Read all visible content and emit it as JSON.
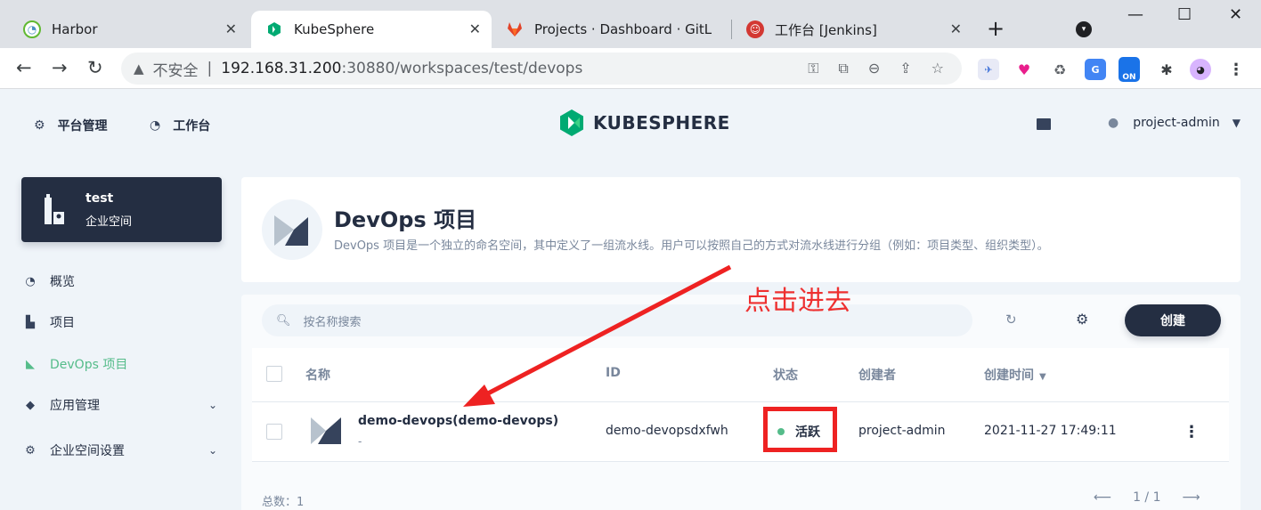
{
  "browser": {
    "tabs": [
      {
        "title": "Harbor",
        "active": false
      },
      {
        "title": "KubeSphere",
        "active": true
      },
      {
        "title": "Projects · Dashboard · GitL",
        "active": false
      },
      {
        "title": "工作台 [Jenkins]",
        "active": false
      }
    ],
    "address": {
      "security_label": "不安全",
      "host": "192.168.31.200",
      "path": ":30880/workspaces/test/devops"
    },
    "extension_badge": "ON"
  },
  "header": {
    "nav": [
      {
        "label": "平台管理"
      },
      {
        "label": "工作台"
      }
    ],
    "logo_text": "KUBESPHERE",
    "user": "project-admin"
  },
  "workspace": {
    "name": "test",
    "type": "企业空间"
  },
  "sidebar": {
    "items": [
      {
        "label": "概览"
      },
      {
        "label": "项目"
      },
      {
        "label": "DevOps 项目"
      },
      {
        "label": "应用管理"
      },
      {
        "label": "企业空间设置"
      }
    ]
  },
  "banner": {
    "title": "DevOps 项目",
    "description": "DevOps 项目是一个独立的命名空间，其中定义了一组流水线。用户可以按照自己的方式对流水线进行分组（例如：项目类型、组织类型）。"
  },
  "list": {
    "search_placeholder": "按名称搜索",
    "create_label": "创建",
    "columns": {
      "name": "名称",
      "id": "ID",
      "status": "状态",
      "creator": "创建者",
      "created_at": "创建时间"
    },
    "rows": [
      {
        "name": "demo-devops(demo-devops)",
        "description": "-",
        "id": "demo-devopsdxfwh",
        "status": "活跃",
        "creator": "project-admin",
        "created_at": "2021-11-27 17:49:11"
      }
    ],
    "total_label": "总数：1",
    "page": "1 / 1"
  },
  "annotation": {
    "text": "点击进去",
    "color": "#ee3030"
  },
  "colors": {
    "accent": "#55bc8a",
    "dark": "#242e42",
    "muted": "#79879c"
  }
}
